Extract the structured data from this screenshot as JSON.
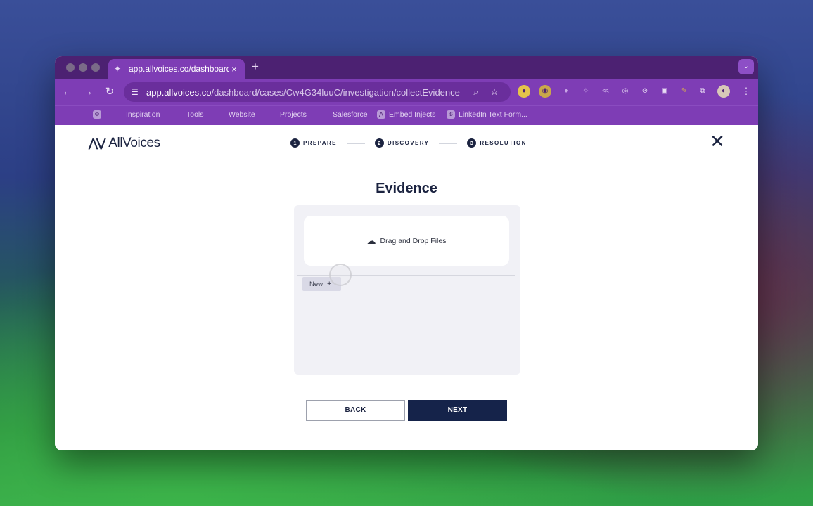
{
  "browser": {
    "tab_title": "app.allvoices.co/dashboard/c",
    "tab_close": "×",
    "new_tab": "+",
    "tab_menu": "⌄",
    "url_host": "app.allvoices.co",
    "url_path": "/dashboard/cases/Cw4G34luuC/investigation/collectEvidence",
    "bookmarks": [
      "Inspiration",
      "Tools",
      "Website",
      "Projects",
      "Salesforce",
      "Embed Injects",
      "LinkedIn Text Form..."
    ]
  },
  "app": {
    "logo_text": "AllVoices",
    "steps": [
      {
        "num": "1",
        "label": "PREPARE"
      },
      {
        "num": "2",
        "label": "DISCOVERY"
      },
      {
        "num": "3",
        "label": "RESOLUTION"
      }
    ],
    "close": "✕",
    "title": "Evidence",
    "dropzone_label": "Drag and Drop Files",
    "new_button": "New",
    "new_plus": "+",
    "back_button": "BACK",
    "next_button": "NEXT"
  }
}
